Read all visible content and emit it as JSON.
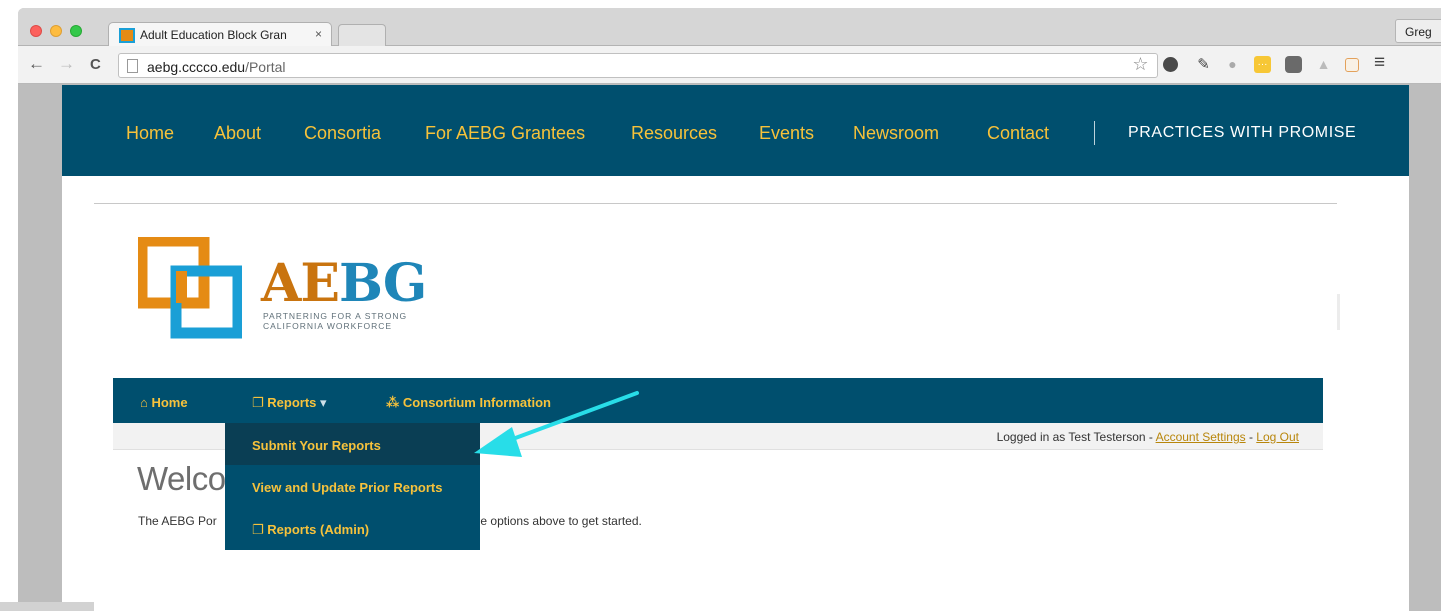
{
  "browser": {
    "tab_title": "Adult Education Block Gran",
    "tab_close": "×",
    "profile_name": "Greg",
    "url_host": "aebg.cccco.edu",
    "url_path": "/Portal",
    "nav_back": "←",
    "nav_forward": "→",
    "nav_reload": "C",
    "extensions": [
      "star-icon",
      "evernote-icon",
      "tools-icon",
      "chat-icon",
      "notes-icon",
      "pocket-icon",
      "drive-icon",
      "calendar-icon",
      "menu-icon"
    ]
  },
  "site_nav": {
    "items": [
      "Home",
      "About",
      "Consortia",
      "For AEBG Grantees",
      "Resources",
      "Events",
      "Newsroom",
      "Contact"
    ],
    "feature_link": "PRACTICES WITH PROMISE"
  },
  "logo": {
    "word_part1": "AE",
    "word_part2": "BG",
    "tagline_line1": "PARTNERING FOR A STRONG",
    "tagline_line2": "CALIFORNIA WORKFORCE"
  },
  "portal_nav": {
    "home": "Home",
    "reports": "Reports",
    "consortium": "Consortium Information"
  },
  "reports_menu": {
    "items": [
      "Submit Your Reports",
      "View and Update Prior Reports",
      "Reports (Admin)"
    ]
  },
  "account_bar": {
    "logged_in_text": "Logged in as Test Testerson - ",
    "account_settings": "Account Settings",
    "separator": " - ",
    "log_out": "Log Out"
  },
  "main": {
    "welcome_visible": "Welco",
    "intro_left": "The AEBG Por",
    "intro_right": ". Select from the options above to get started."
  },
  "colors": {
    "nav_bg": "#004f6e",
    "nav_text": "#f7c23a",
    "logo_orange": "#e58b14",
    "logo_blue": "#1a9fd6",
    "annotation_arrow": "#28dde8"
  }
}
